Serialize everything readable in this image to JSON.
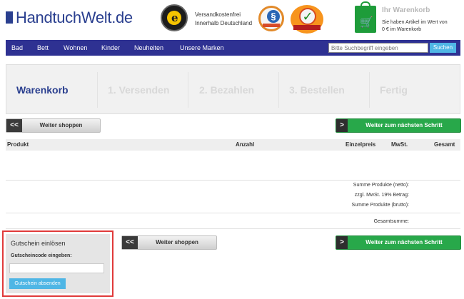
{
  "header": {
    "logo_part1": "Handtuch",
    "logo_part2": "Welt",
    "logo_part3": ".de",
    "shipping_line1": "Versandkostenfrei",
    "shipping_line2": "Innerhalb Deutschland",
    "cart_title": "Ihr Warenkorb",
    "cart_line1": "Sie haben Artikel im Wert von",
    "cart_line2": "0 € im Warenkorb"
  },
  "nav": {
    "items": [
      "Bad",
      "Bett",
      "Wohnen",
      "Kinder",
      "Neuheiten",
      "Unsere Marken"
    ],
    "search_placeholder": "Bitte Suchbegriff eingeben",
    "search_button": "Suchen"
  },
  "steps": [
    "Warenkorb",
    "1. Versenden",
    "2. Bezahlen",
    "3. Bestellen",
    "Fertig"
  ],
  "buttons": {
    "continue_shopping": "Weiter shoppen",
    "next_step": "Weiter zum nächsten Schritt",
    "back_arrow": "<<",
    "next_arrow": ">"
  },
  "table": {
    "columns": [
      "Produkt",
      "Anzahl",
      "Einzelpreis",
      "MwSt.",
      "Gesamt"
    ],
    "summary": {
      "net": "Summe Produkte (netto):",
      "vat": "zzgl. MwSt. 19% Betrag:",
      "gross": "Summe Produkte (brutto):",
      "total": "Gesamtsumme:"
    }
  },
  "voucher": {
    "title": "Gutschein einlösen",
    "label": "Gutscheincode eingeben:",
    "value": "",
    "button": "Gutschein absenden"
  },
  "colors": {
    "brand_blue": "#2a3f8f",
    "nav_bg": "#2e3192",
    "accent_green": "#28a84a",
    "button_light_blue": "#4fb6e5",
    "highlight_red": "#e03a3a"
  }
}
